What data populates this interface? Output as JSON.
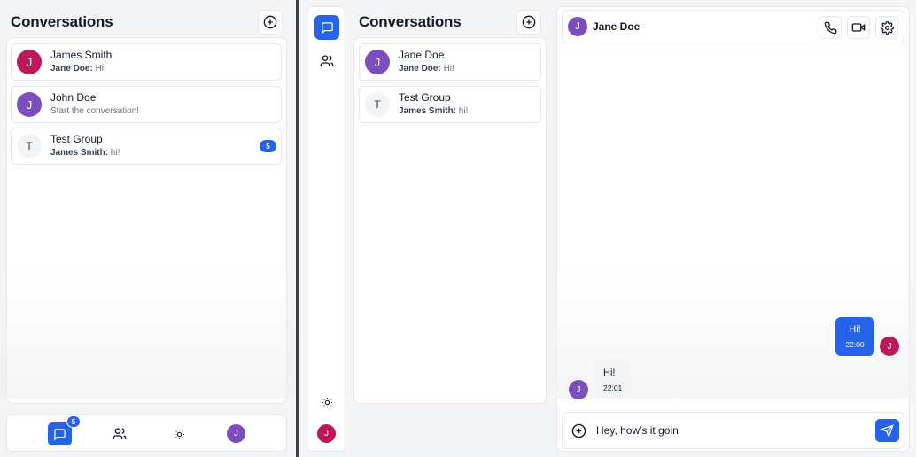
{
  "colors": {
    "accent": "#2563eb",
    "avatar_james": "#be185d",
    "avatar_john": "#7c4dbf",
    "avatar_jane": "#7c4dbf",
    "avatar_self": "#be185d"
  },
  "left": {
    "title": "Conversations",
    "conversations": [
      {
        "initial": "J",
        "name": "James Smith",
        "preview_sender": "Jane Doe:",
        "preview_text": " Hi!"
      },
      {
        "initial": "J",
        "name": "John Doe",
        "preview_sender": "",
        "preview_text": "Start the conversation!"
      },
      {
        "initial": "T",
        "name": "Test Group",
        "preview_sender": "James Smith:",
        "preview_text": " hi!",
        "unread": "5"
      }
    ],
    "nav": {
      "chats_badge": "5",
      "user_initial": "J",
      "icons": [
        "chat-icon",
        "users-icon",
        "sun-icon",
        "avatar"
      ]
    }
  },
  "right": {
    "title": "Conversations",
    "conversations": [
      {
        "initial": "J",
        "name": "Jane Doe",
        "preview_sender": "Jane Doe:",
        "preview_text": " Hi!"
      },
      {
        "initial": "T",
        "name": "Test Group",
        "preview_sender": "James Smith:",
        "preview_text": " hi!"
      }
    ],
    "rail": {
      "user_initial": "J"
    },
    "chat": {
      "contact_initial": "J",
      "contact_name": "Jane Doe",
      "messages": [
        {
          "direction": "sent",
          "text": "Hi!",
          "time": "22:00",
          "avatar_initial": "J"
        },
        {
          "direction": "received",
          "text": "Hi!",
          "time": "22:01",
          "avatar_initial": "J"
        }
      ],
      "composer_value": "Hey, how's it goin"
    }
  }
}
